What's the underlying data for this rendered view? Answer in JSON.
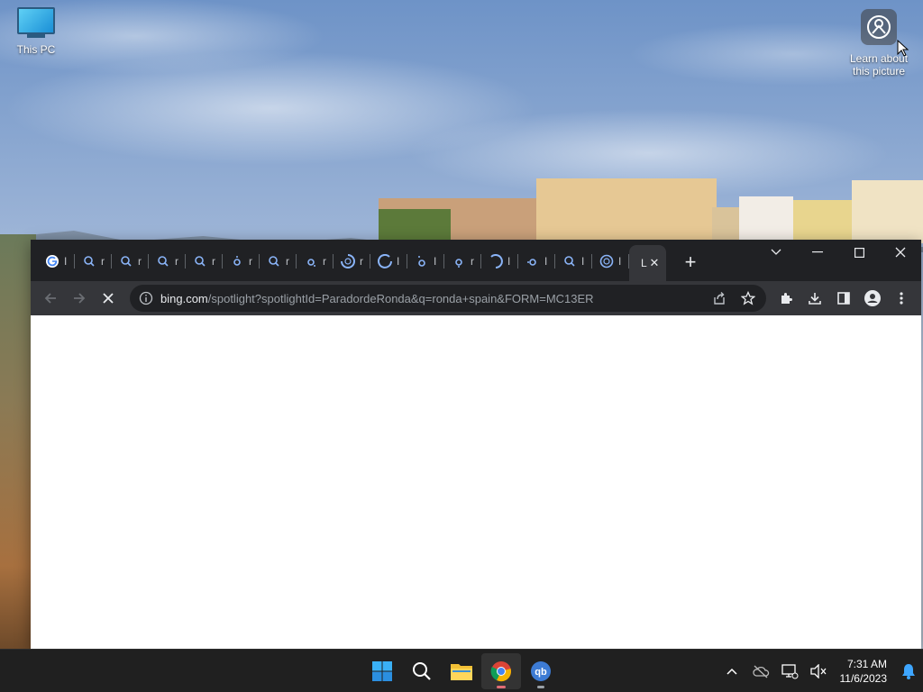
{
  "desktop": {
    "icons": [
      {
        "label": "This PC"
      },
      {
        "label": "Learn about\nthis picture"
      }
    ]
  },
  "browser": {
    "tabs": [
      {
        "icon": "google-icon",
        "title": "I"
      },
      {
        "icon": "search-icon",
        "title": "r"
      },
      {
        "icon": "search-icon",
        "title": "r"
      },
      {
        "icon": "search-icon",
        "title": "r"
      },
      {
        "icon": "search-icon",
        "title": "r"
      },
      {
        "icon": "loading-icon",
        "title": "r"
      },
      {
        "icon": "search-icon",
        "title": "r"
      },
      {
        "icon": "loading-icon",
        "title": "r"
      },
      {
        "icon": "loading-spinner-icon",
        "title": "r"
      },
      {
        "icon": "loading-spinner-icon",
        "title": "I"
      },
      {
        "icon": "loading-icon",
        "title": "I"
      },
      {
        "icon": "loading-icon",
        "title": "r"
      },
      {
        "icon": "loading-spinner-icon",
        "title": "I"
      },
      {
        "icon": "loading-icon",
        "title": "I"
      },
      {
        "icon": "search-icon",
        "title": "I"
      },
      {
        "icon": "loading-spinner-icon",
        "title": "I"
      },
      {
        "icon": "none",
        "title": "L",
        "active": true
      }
    ],
    "address": {
      "host": "bing.com",
      "path": "/spotlight?spotlightId=ParadordeRonda&q=ronda+spain&FORM=MC13ER"
    }
  },
  "taskbar": {
    "apps": [
      "windows-start",
      "search",
      "file-explorer",
      "chrome",
      "qbittorrent"
    ],
    "clock": {
      "time": "7:31 AM",
      "date": "11/6/2023"
    }
  },
  "colors": {
    "tabstrip": "#202124",
    "toolbar": "#35363a",
    "taskbar": "#202020",
    "accent": "#1a73e8"
  }
}
